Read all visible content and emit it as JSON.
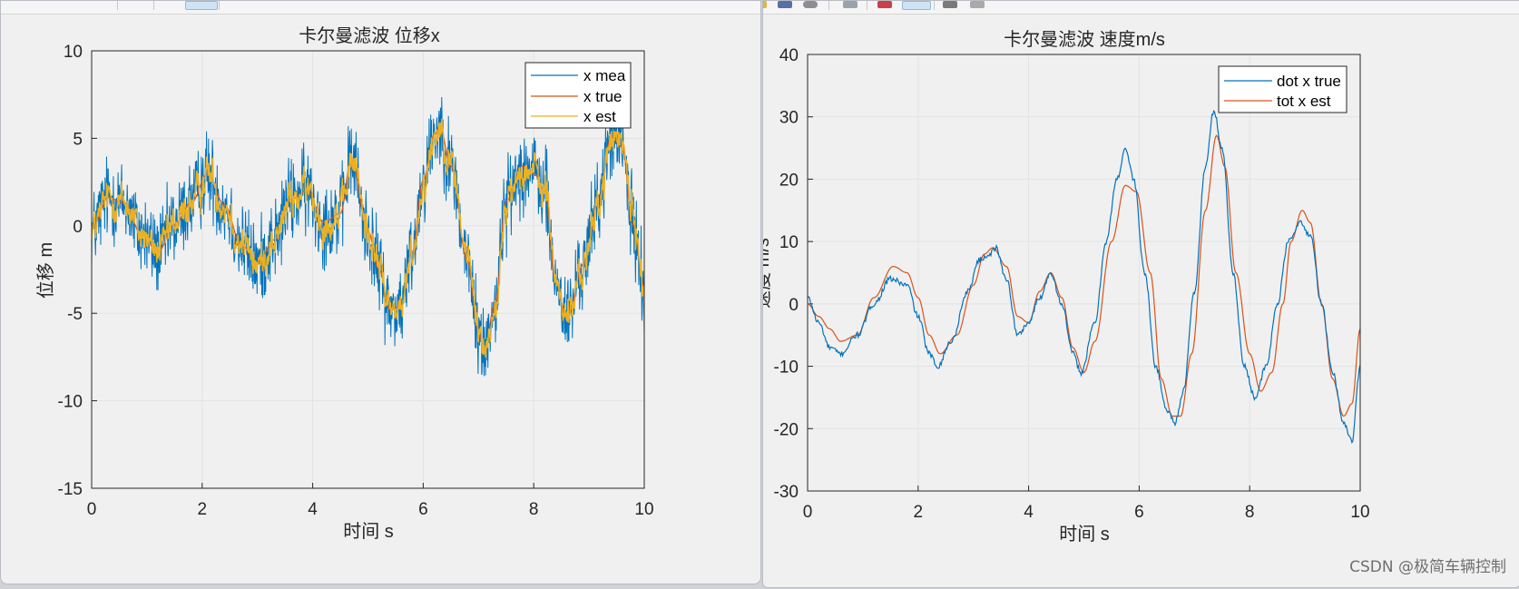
{
  "left_window": {
    "chart_data": {
      "type": "line",
      "title": "卡尔曼滤波 位移x",
      "xlabel": "时间 s",
      "ylabel": "位移 m",
      "xlim": [
        0,
        10
      ],
      "ylim": [
        -15,
        10
      ],
      "xticks": [
        "0",
        "2",
        "4",
        "6",
        "8",
        "10"
      ],
      "yticks": [
        "10",
        "5",
        "0",
        "-5",
        "-10",
        "-15"
      ],
      "grid": true,
      "legend_position": "top-right",
      "series": [
        {
          "name": "x mea",
          "color": "#0072BD"
        },
        {
          "name": "x true",
          "color": "#D95319"
        },
        {
          "name": "x est",
          "color": "#EDB120"
        }
      ],
      "x": [
        0,
        0.3,
        0.6,
        0.9,
        1.2,
        1.5,
        1.8,
        2.1,
        2.4,
        2.7,
        3.0,
        3.3,
        3.6,
        3.9,
        4.2,
        4.5,
        4.7,
        5.0,
        5.2,
        5.4,
        5.6,
        5.8,
        6.0,
        6.2,
        6.3,
        6.5,
        6.8,
        7.0,
        7.1,
        7.3,
        7.5,
        7.8,
        8.0,
        8.2,
        8.4,
        8.6,
        8.9,
        9.2,
        9.4,
        9.6,
        9.8,
        10.0
      ],
      "x_true_values": [
        -0.2,
        1.6,
        1.3,
        -0.5,
        -1.5,
        0.1,
        1.3,
        3.0,
        1.2,
        -1.0,
        -2.2,
        -0.8,
        1.5,
        2.0,
        0.2,
        0.7,
        3.8,
        -0.3,
        -2.5,
        -4.8,
        -4.6,
        -1.5,
        2.6,
        5.2,
        5.7,
        3.4,
        -2.0,
        -6.0,
        -7.1,
        -4.5,
        1.4,
        3.4,
        3.0,
        2.0,
        -3.3,
        -5.3,
        -2.2,
        1.8,
        5.1,
        4.5,
        0.0,
        -3.5
      ],
      "noise_amplitude": 1.2
    }
  },
  "right_window": {
    "chart_data": {
      "type": "line",
      "title": "卡尔曼滤波 速度m/s",
      "xlabel": "时间 s",
      "ylabel": "速度 m/s",
      "xlim": [
        0,
        10
      ],
      "ylim": [
        -30,
        40
      ],
      "xticks": [
        "0",
        "2",
        "4",
        "6",
        "8",
        "10"
      ],
      "yticks": [
        "40",
        "30",
        "20",
        "10",
        "0",
        "-10",
        "-20",
        "-30"
      ],
      "grid": true,
      "legend_position": "top-right",
      "series": [
        {
          "name": "dot x true",
          "color": "#0072BD",
          "x": [
            0,
            0.2,
            0.4,
            0.6,
            0.9,
            1.2,
            1.5,
            1.8,
            2.0,
            2.2,
            2.35,
            2.6,
            2.9,
            3.1,
            3.3,
            3.4,
            3.6,
            3.8,
            4.0,
            4.2,
            4.4,
            4.6,
            4.8,
            4.95,
            5.2,
            5.4,
            5.6,
            5.75,
            5.9,
            6.1,
            6.3,
            6.5,
            6.65,
            6.8,
            7.0,
            7.2,
            7.35,
            7.5,
            7.7,
            7.9,
            8.1,
            8.3,
            8.5,
            8.7,
            8.9,
            9.1,
            9.3,
            9.5,
            9.7,
            9.85,
            10.0
          ],
          "values": [
            1,
            -3,
            -7,
            -8,
            -5,
            0,
            4,
            3,
            -2,
            -8,
            -10,
            -6,
            2,
            7,
            8,
            9,
            4,
            -5,
            -3,
            1,
            5,
            0,
            -8,
            -11,
            -3,
            10,
            20,
            25,
            20,
            5,
            -10,
            -17,
            -19,
            -14,
            2,
            22,
            31,
            25,
            5,
            -10,
            -15,
            -10,
            0,
            10,
            13,
            11,
            0,
            -11,
            -19,
            -22,
            -10
          ]
        },
        {
          "name": "tot x est",
          "color": "#D95319",
          "x": [
            0,
            0.2,
            0.4,
            0.6,
            0.9,
            1.2,
            1.55,
            1.8,
            2.0,
            2.2,
            2.4,
            2.7,
            3.0,
            3.2,
            3.35,
            3.6,
            3.8,
            4.0,
            4.2,
            4.4,
            4.6,
            4.8,
            5.0,
            5.2,
            5.5,
            5.75,
            5.95,
            6.2,
            6.4,
            6.6,
            6.75,
            6.95,
            7.2,
            7.4,
            7.55,
            7.75,
            8.0,
            8.2,
            8.4,
            8.6,
            8.75,
            8.95,
            9.1,
            9.3,
            9.5,
            9.7,
            9.85,
            10.0
          ],
          "values": [
            0,
            -2,
            -4,
            -6,
            -5,
            1,
            6,
            5,
            1,
            -5,
            -8,
            -5,
            3,
            8,
            9,
            6,
            -2,
            -3,
            2,
            5,
            1,
            -7,
            -11,
            -6,
            10,
            19,
            18,
            5,
            -12,
            -18,
            -18,
            -8,
            15,
            27,
            22,
            5,
            -8,
            -14,
            -11,
            0,
            10,
            15,
            13,
            0,
            -12,
            -18,
            -16,
            -4
          ]
        }
      ]
    }
  },
  "watermark": "CSDN @极简车辆控制"
}
